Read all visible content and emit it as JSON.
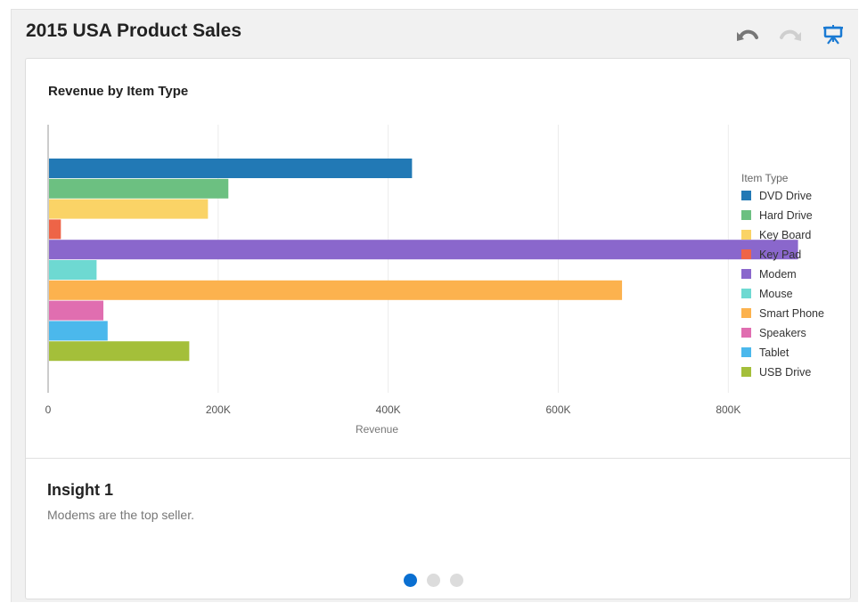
{
  "header": {
    "title": "2015 USA Product Sales",
    "icons": [
      "undo-icon",
      "redo-icon",
      "presentation-icon"
    ],
    "accent_color": "#1a7ad3"
  },
  "chart_data": {
    "type": "bar",
    "orientation": "horizontal",
    "title": "Revenue by Item Type",
    "xlabel": "Revenue",
    "ylabel": "",
    "xlim": [
      0,
      960000
    ],
    "ticks": [
      0,
      200000,
      400000,
      600000,
      800000
    ],
    "tick_labels": [
      "0",
      "200K",
      "400K",
      "600K",
      "800K"
    ],
    "grid": true,
    "legend_title": "Item Type",
    "legend_position": "right",
    "categories": [
      "DVD Drive",
      "Hard Drive",
      "Key Board",
      "Key Pad",
      "Modem",
      "Mouse",
      "Smart Phone",
      "Speakers",
      "Tablet",
      "USB Drive"
    ],
    "values": [
      428000,
      212000,
      188000,
      15000,
      882000,
      57000,
      675000,
      65000,
      70000,
      166000
    ],
    "colors": [
      "#2279b5",
      "#6cc081",
      "#fad366",
      "#ee6447",
      "#8a67cc",
      "#6ed9d2",
      "#fcb24e",
      "#e06eb0",
      "#4bb8ec",
      "#a4bf3a"
    ]
  },
  "insight": {
    "title": "Insight 1",
    "text": "Modems are the top seller."
  },
  "pager": {
    "active_page": 1,
    "page_count": 3
  }
}
